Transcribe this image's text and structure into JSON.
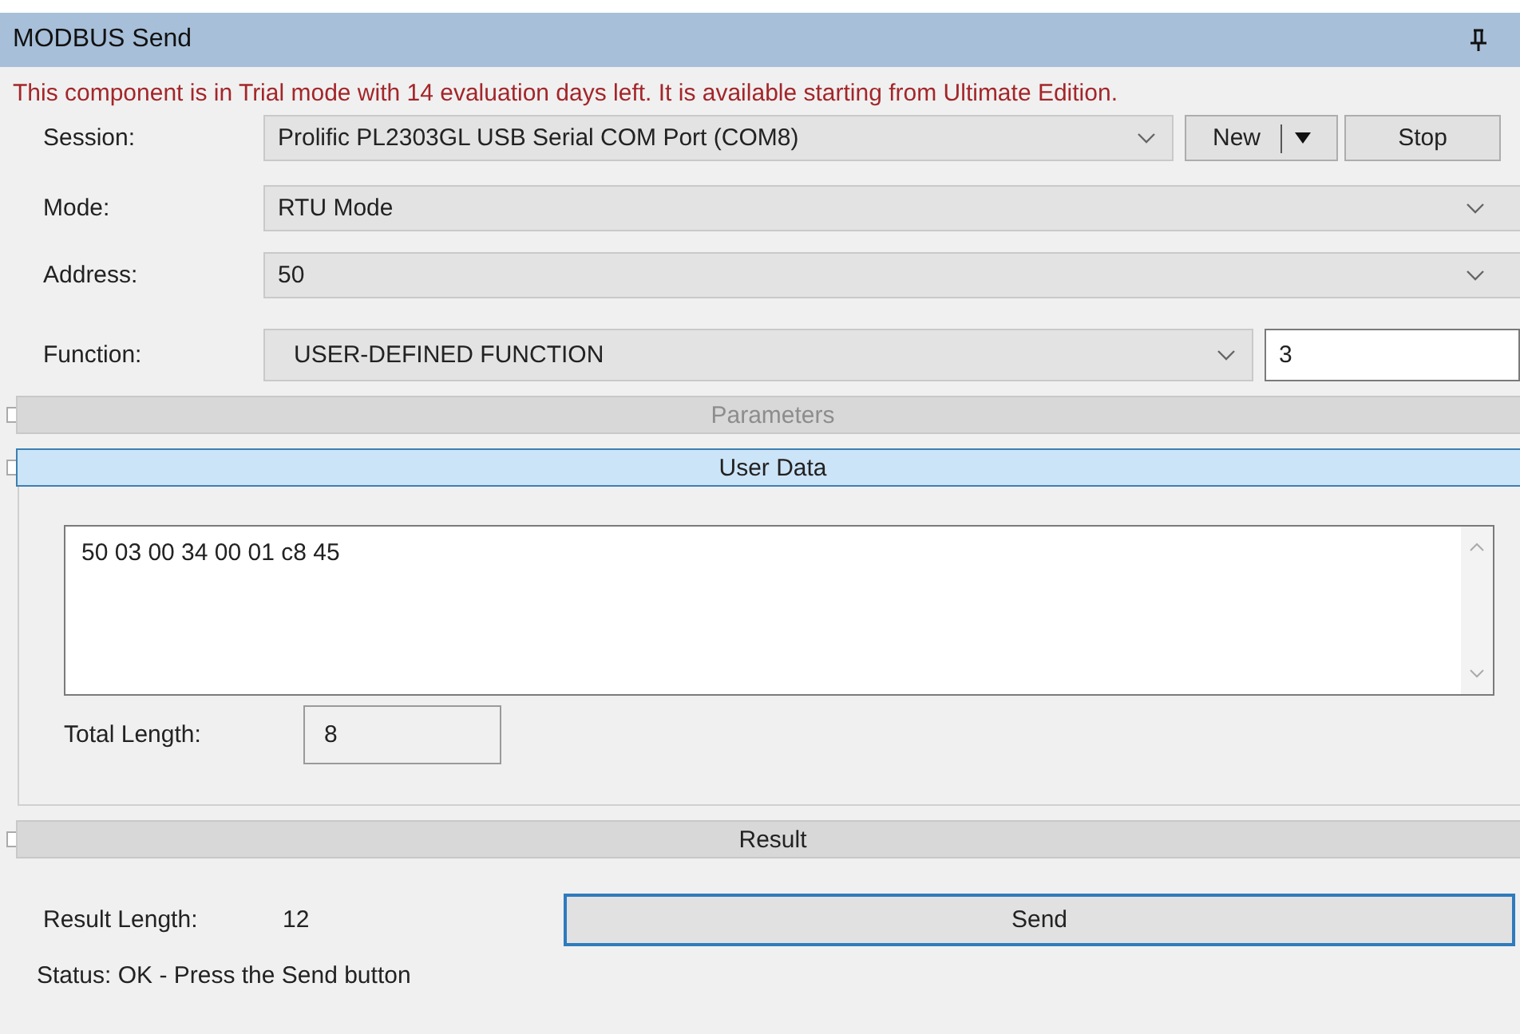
{
  "window": {
    "title": "MODBUS Send"
  },
  "trial_notice": "This component is in Trial mode with 14 evaluation days left. It is available starting from Ultimate Edition.",
  "session": {
    "label": "Session:",
    "value": "Prolific PL2303GL USB Serial COM Port (COM8)",
    "new_button": "New",
    "stop_button": "Stop"
  },
  "mode": {
    "label": "Mode:",
    "value": "RTU Mode"
  },
  "address": {
    "label": "Address:",
    "value": "50"
  },
  "function": {
    "label": "Function:",
    "value": "USER-DEFINED FUNCTION",
    "code": "3"
  },
  "sections": [
    {
      "label": "Parameters",
      "expanded": false,
      "disabled": true
    },
    {
      "label": "User Data",
      "expanded": true,
      "disabled": false
    }
  ],
  "user_data": {
    "value": "50 03 00 34 00 01 c8 45",
    "total_length_label": "Total Length:",
    "total_length": "8"
  },
  "result_section": {
    "label": "Result",
    "expanded": false,
    "disabled": false
  },
  "result_length_label": "Result Length:",
  "result_length": "12",
  "send_button": "Send",
  "status": "Status: OK - Press the Send button"
}
